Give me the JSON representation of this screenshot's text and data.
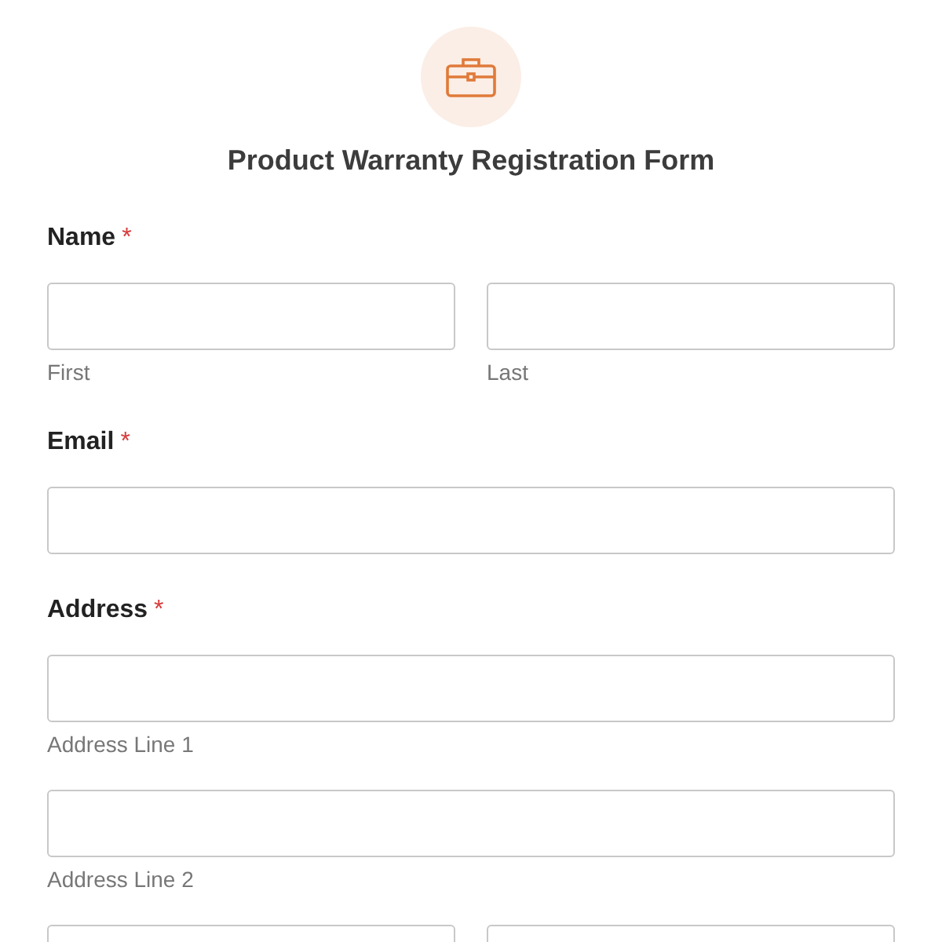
{
  "form": {
    "title": "Product Warranty Registration Form",
    "required_mark": "*",
    "fields": [
      {
        "label": "Name",
        "required": true,
        "rows": [
          [
            {
              "sublabel": "First"
            },
            {
              "sublabel": "Last"
            }
          ]
        ]
      },
      {
        "label": "Email",
        "required": true,
        "rows": [
          [
            {}
          ]
        ]
      },
      {
        "label": "Address",
        "required": true,
        "rows": [
          [
            {
              "sublabel": "Address Line 1"
            }
          ],
          [
            {
              "sublabel": "Address Line 2"
            }
          ],
          [
            {},
            {}
          ]
        ]
      }
    ]
  }
}
